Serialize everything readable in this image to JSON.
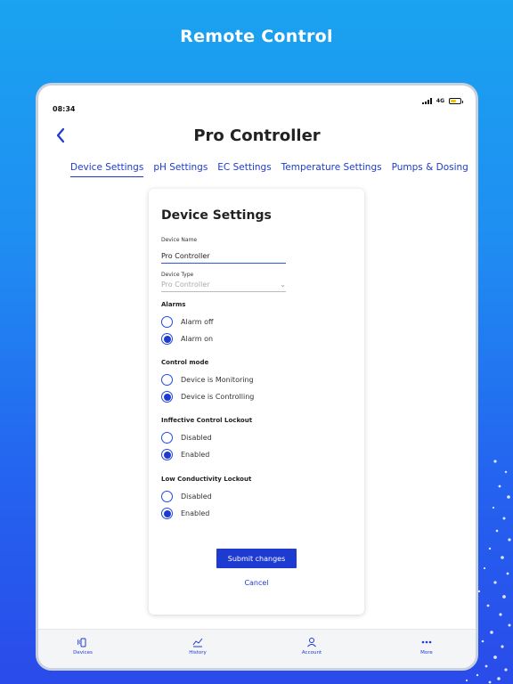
{
  "headline": "Remote Control",
  "status_bar": {
    "time": "08:34",
    "network": "4G"
  },
  "header": {
    "title": "Pro Controller"
  },
  "tabs": [
    {
      "label": "Device Settings",
      "active": true
    },
    {
      "label": "pH Settings",
      "active": false
    },
    {
      "label": "EC Settings",
      "active": false
    },
    {
      "label": "Temperature Settings",
      "active": false
    },
    {
      "label": "Pumps & Dosing",
      "active": false
    }
  ],
  "card": {
    "title": "Device Settings",
    "device_name": {
      "label": "Device Name",
      "value": "Pro Controller"
    },
    "device_type": {
      "label": "Device Type",
      "placeholder": "Pro Controller"
    },
    "groups": [
      {
        "title": "Alarms",
        "options": [
          {
            "label": "Alarm off",
            "selected": false
          },
          {
            "label": "Alarm on",
            "selected": true
          }
        ]
      },
      {
        "title": "Control mode",
        "options": [
          {
            "label": "Device is Monitoring",
            "selected": false
          },
          {
            "label": "Device is Controlling",
            "selected": true
          }
        ]
      },
      {
        "title": "Inffective Control Lockout",
        "options": [
          {
            "label": "Disabled",
            "selected": false
          },
          {
            "label": "Enabled",
            "selected": true
          }
        ]
      },
      {
        "title": "Low Conductivity Lockout",
        "options": [
          {
            "label": "Disabled",
            "selected": false
          },
          {
            "label": "Enabled",
            "selected": true
          }
        ]
      }
    ],
    "submit_label": "Submit changes",
    "cancel_label": "Cancel"
  },
  "bottom_nav": [
    {
      "label": "Devices",
      "icon": "devices-icon"
    },
    {
      "label": "History",
      "icon": "chart-icon"
    },
    {
      "label": "Account",
      "icon": "account-icon"
    },
    {
      "label": "More",
      "icon": "more-icon"
    }
  ],
  "colors": {
    "accent": "#1d3bd1",
    "battery": "#f2c300"
  }
}
